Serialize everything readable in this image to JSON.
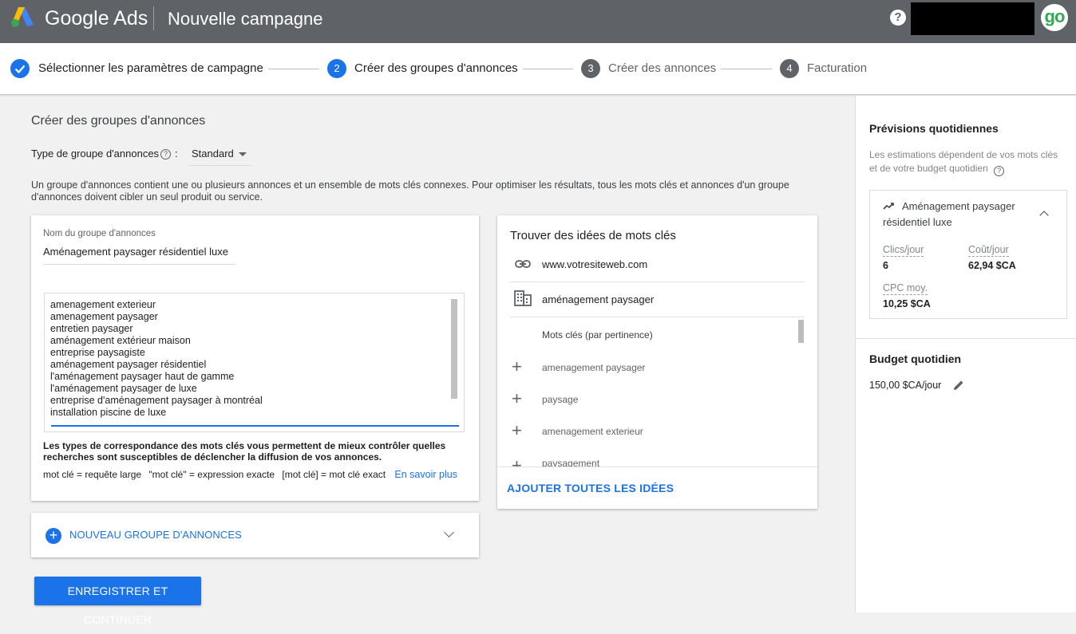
{
  "header": {
    "brand": "Google Ads",
    "page_title": "Nouvelle campagne",
    "help_glyph": "?",
    "avatar_text": "go",
    "colors": {
      "bar": "#5f6368",
      "accent": "#1a73e8",
      "avatar": "#34a853"
    }
  },
  "stepper": {
    "steps": [
      {
        "number": "1",
        "label": "Sélectionner les paramètres de campagne",
        "state": "done"
      },
      {
        "number": "2",
        "label": "Créer des groupes d'annonces",
        "state": "active"
      },
      {
        "number": "3",
        "label": "Créer des annonces",
        "state": "upcoming"
      },
      {
        "number": "4",
        "label": "Facturation",
        "state": "upcoming"
      }
    ]
  },
  "main": {
    "title": "Créer des groupes d'annonces",
    "type_label": "Type de groupe d'annonces",
    "type_colon": ":",
    "type_value": "Standard",
    "description": "Un groupe d'annonces contient une ou plusieurs annonces et un ensemble de mots clés connexes. Pour optimiser les résultats, tous les mots clés et annonces d'un groupe d'annonces doivent cibler un seul produit ou service."
  },
  "ad_group": {
    "name_label": "Nom du groupe d'annonces",
    "name_value": "Aménagement paysager résidentiel luxe",
    "keywords": [
      "amenagement exterieur",
      "amenagement paysager",
      "entretien paysager",
      "aménagement extérieur maison",
      "entreprise paysagiste",
      "aménagement paysager résidentiel",
      "l'aménagement paysager haut de gamme",
      "l'aménagement paysager de luxe",
      "entreprise d'aménagement paysager à montréal",
      "installation piscine de luxe"
    ],
    "match_note": "Les types de correspondance des mots clés vous permettent de mieux contrôler quelles recherches sont susceptibles de déclencher la diffusion de vos annonces.",
    "match_broad": "mot clé = requête large",
    "match_phrase": "\"mot clé\" = expression exacte",
    "match_exact": "[mot clé] = mot clé exact",
    "learn_more": "En savoir plus"
  },
  "new_group": {
    "label": "NOUVEAU GROUPE D'ANNONCES",
    "plus_glyph": "+"
  },
  "save_button": "ENREGISTRER ET CONTINUER",
  "ideas": {
    "title": "Trouver des idées de mots clés",
    "website": "www.votresiteweb.com",
    "product": "aménagement paysager",
    "keywords_header": "Mots clés (par pertinence)",
    "items": [
      "amenagement paysager",
      "paysage",
      "amenagement exterieur",
      "paysagement"
    ],
    "plus_glyph": "+",
    "add_all": "AJOUTER TOUTES LES IDÉES"
  },
  "forecast": {
    "title": "Prévisions quotidiennes",
    "description": "Les estimations dépendent de vos mots clés et de votre budget quotidien",
    "group_name": "Aménagement paysager résidentiel luxe",
    "clicks_label": "Clics/jour",
    "clicks_value": "6",
    "cost_label": "Coût/jour",
    "cost_value": "62,94 $CA",
    "cpc_label": "CPC moy.",
    "cpc_value": "10,25 $CA",
    "budget_title": "Budget quotidien",
    "budget_value": "150,00 $CA/jour"
  }
}
